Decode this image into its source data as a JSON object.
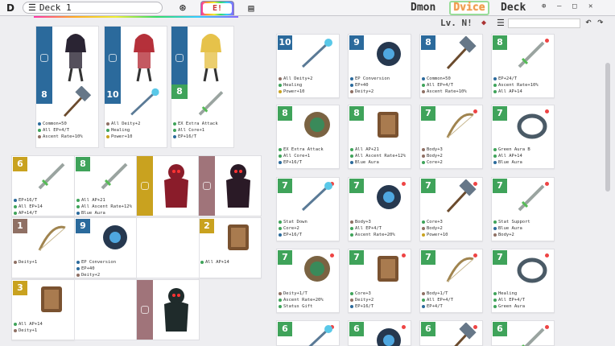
{
  "app": {
    "title": "Deck 1",
    "tab_e": "E!"
  },
  "top_tabs": [
    {
      "label": "Dmon"
    },
    {
      "label": "Dvice"
    },
    {
      "label": "Deck"
    }
  ],
  "window": {
    "pin": "⊕",
    "min": "—",
    "max": "□",
    "close": "✕"
  },
  "toolbar": {
    "lvn": "Lv. N!"
  },
  "colors": {
    "blue": "#2b6a9c",
    "green": "#3fa35a",
    "gold": "#c9a21f",
    "brown": "#8f7064",
    "rose": "#a0747a",
    "red": "#e44"
  },
  "left_tall": [
    {
      "badge": "8",
      "color": "blue",
      "stats": [
        {
          "c": "#2b6a9c",
          "t": "Common+50"
        },
        {
          "c": "#3fa35a",
          "t": "All EP+4/T"
        },
        {
          "c": "#8f7064",
          "t": "Ascent Rate+10%"
        }
      ]
    },
    {
      "badge": "10",
      "color": "blue",
      "stats": [
        {
          "c": "#8f7064",
          "t": "All Deity+2"
        },
        {
          "c": "#3fa35a",
          "t": "Healing"
        },
        {
          "c": "#c9a21f",
          "t": "Power+10"
        }
      ]
    },
    {
      "badge": "8",
      "color": "green",
      "stats": [
        {
          "c": "#3fa35a",
          "t": "EX Extra Attack"
        },
        {
          "c": "#3fa35a",
          "t": "All Core+1"
        },
        {
          "c": "#2b6a9c",
          "t": "EP+16/T"
        }
      ]
    }
  ],
  "left_cards": [
    {
      "badge": "6",
      "color": "gold",
      "stats": [
        {
          "c": "#2b6a9c",
          "t": "EP+16/T"
        },
        {
          "c": "#3fa35a",
          "t": "All EP+14"
        },
        {
          "c": "#3fa35a",
          "t": "AP+14/T"
        }
      ]
    },
    {
      "badge": "8",
      "color": "green",
      "stats": [
        {
          "c": "#3fa35a",
          "t": "All AP+21"
        },
        {
          "c": "#3fa35a",
          "t": "All Ascent Rate+12%"
        },
        {
          "c": "#2b6a9c",
          "t": "Blue Aura"
        }
      ]
    },
    {
      "badge": "1",
      "color": "brown",
      "stats": [
        {
          "c": "#8f7064",
          "t": "Deity+1"
        }
      ]
    },
    {
      "badge": "9",
      "color": "blue",
      "stats": [
        {
          "c": "#2b6a9c",
          "t": "EP Conversion"
        },
        {
          "c": "#2b6a9c",
          "t": "EP+40"
        },
        {
          "c": "#8f7064",
          "t": "Deity+2"
        }
      ]
    },
    {
      "badge": "2",
      "color": "gold",
      "stats": [
        {
          "c": "#3fa35a",
          "t": "All AP+14"
        }
      ]
    },
    {
      "badge": "3",
      "color": "gold",
      "stats": [
        {
          "c": "#3fa35a",
          "t": "All AP+14"
        },
        {
          "c": "#8f7064",
          "t": "Deity+1"
        }
      ]
    }
  ],
  "right_cards": [
    {
      "badge": "10",
      "color": "blue",
      "dot": false,
      "stats": [
        {
          "c": "#8f7064",
          "t": "All Deity+2"
        },
        {
          "c": "#3fa35a",
          "t": "Healing"
        },
        {
          "c": "#c9a21f",
          "t": "Power+10"
        }
      ]
    },
    {
      "badge": "9",
      "color": "blue",
      "dot": false,
      "stats": [
        {
          "c": "#2b6a9c",
          "t": "EP Conversion"
        },
        {
          "c": "#2b6a9c",
          "t": "EP+40"
        },
        {
          "c": "#8f7064",
          "t": "Deity+2"
        }
      ]
    },
    {
      "badge": "8",
      "color": "blue",
      "dot": false,
      "stats": [
        {
          "c": "#2b6a9c",
          "t": "Common+50"
        },
        {
          "c": "#3fa35a",
          "t": "All EP+4/T"
        },
        {
          "c": "#8f7064",
          "t": "Ascent Rate+10%"
        }
      ]
    },
    {
      "badge": "8",
      "color": "green",
      "dot": true,
      "stats": [
        {
          "c": "#2b6a9c",
          "t": "EP+24/T"
        },
        {
          "c": "#3fa35a",
          "t": "Ascent Rate+10%"
        },
        {
          "c": "#3fa35a",
          "t": "All AP+14"
        }
      ]
    },
    {
      "badge": "8",
      "color": "green",
      "dot": false,
      "stats": [
        {
          "c": "#3fa35a",
          "t": "EX Extra Attack"
        },
        {
          "c": "#3fa35a",
          "t": "All Core+1"
        },
        {
          "c": "#2b6a9c",
          "t": "EP+16/T"
        }
      ]
    },
    {
      "badge": "8",
      "color": "green",
      "dot": false,
      "stats": [
        {
          "c": "#3fa35a",
          "t": "All AP+21"
        },
        {
          "c": "#3fa35a",
          "t": "All Ascent Rate+12%"
        },
        {
          "c": "#2b6a9c",
          "t": "Blue Aura"
        }
      ]
    },
    {
      "badge": "7",
      "color": "green",
      "dot": true,
      "stats": [
        {
          "c": "#8f7064",
          "t": "Body+3"
        },
        {
          "c": "#8f7064",
          "t": "Body+2"
        },
        {
          "c": "#3fa35a",
          "t": "Core+2"
        }
      ]
    },
    {
      "badge": "7",
      "color": "green",
      "dot": true,
      "stats": [
        {
          "c": "#3fa35a",
          "t": "Green Aura B"
        },
        {
          "c": "#3fa35a",
          "t": "All AP+14"
        },
        {
          "c": "#2b6a9c",
          "t": "Blue Aura"
        }
      ]
    },
    {
      "badge": "7",
      "color": "green",
      "dot": true,
      "stats": [
        {
          "c": "#3fa35a",
          "t": "Stat Down"
        },
        {
          "c": "#3fa35a",
          "t": "Core+2"
        },
        {
          "c": "#2b6a9c",
          "t": "EP+16/T"
        }
      ]
    },
    {
      "badge": "7",
      "color": "green",
      "dot": true,
      "stats": [
        {
          "c": "#8f7064",
          "t": "Body+3"
        },
        {
          "c": "#3fa35a",
          "t": "All EP+4/T"
        },
        {
          "c": "#3fa35a",
          "t": "Ascent Rate+20%"
        }
      ]
    },
    {
      "badge": "7",
      "color": "green",
      "dot": true,
      "stats": [
        {
          "c": "#3fa35a",
          "t": "Core+3"
        },
        {
          "c": "#8f7064",
          "t": "Body+2"
        },
        {
          "c": "#c9a21f",
          "t": "Power+10"
        }
      ]
    },
    {
      "badge": "7",
      "color": "green",
      "dot": true,
      "stats": [
        {
          "c": "#3fa35a",
          "t": "Stat Support"
        },
        {
          "c": "#2b6a9c",
          "t": "Blue Aura"
        },
        {
          "c": "#8f7064",
          "t": "Body+2"
        }
      ]
    },
    {
      "badge": "7",
      "color": "green",
      "dot": true,
      "stats": [
        {
          "c": "#8f7064",
          "t": "Deity+1/T"
        },
        {
          "c": "#3fa35a",
          "t": "Ascent Rate+20%"
        },
        {
          "c": "#3fa35a",
          "t": "Status Gift"
        }
      ]
    },
    {
      "badge": "7",
      "color": "green",
      "dot": true,
      "stats": [
        {
          "c": "#3fa35a",
          "t": "Core+3"
        },
        {
          "c": "#8f7064",
          "t": "Deity+2"
        },
        {
          "c": "#2b6a9c",
          "t": "EP+16/T"
        }
      ]
    },
    {
      "badge": "7",
      "color": "green",
      "dot": true,
      "stats": [
        {
          "c": "#8f7064",
          "t": "Body+1/T"
        },
        {
          "c": "#3fa35a",
          "t": "All EP+4/T"
        },
        {
          "c": "#2b6a9c",
          "t": "EP+4/T"
        }
      ]
    },
    {
      "badge": "7",
      "color": "green",
      "dot": true,
      "stats": [
        {
          "c": "#3fa35a",
          "t": "Healing"
        },
        {
          "c": "#3fa35a",
          "t": "All EP+4/T"
        },
        {
          "c": "#3fa35a",
          "t": "Green Aura"
        }
      ]
    },
    {
      "badge": "6",
      "color": "green",
      "dot": true,
      "stats": []
    },
    {
      "badge": "6",
      "color": "green",
      "dot": true,
      "stats": []
    },
    {
      "badge": "6",
      "color": "green",
      "dot": true,
      "stats": []
    },
    {
      "badge": "6",
      "color": "green",
      "dot": true,
      "stats": []
    }
  ]
}
